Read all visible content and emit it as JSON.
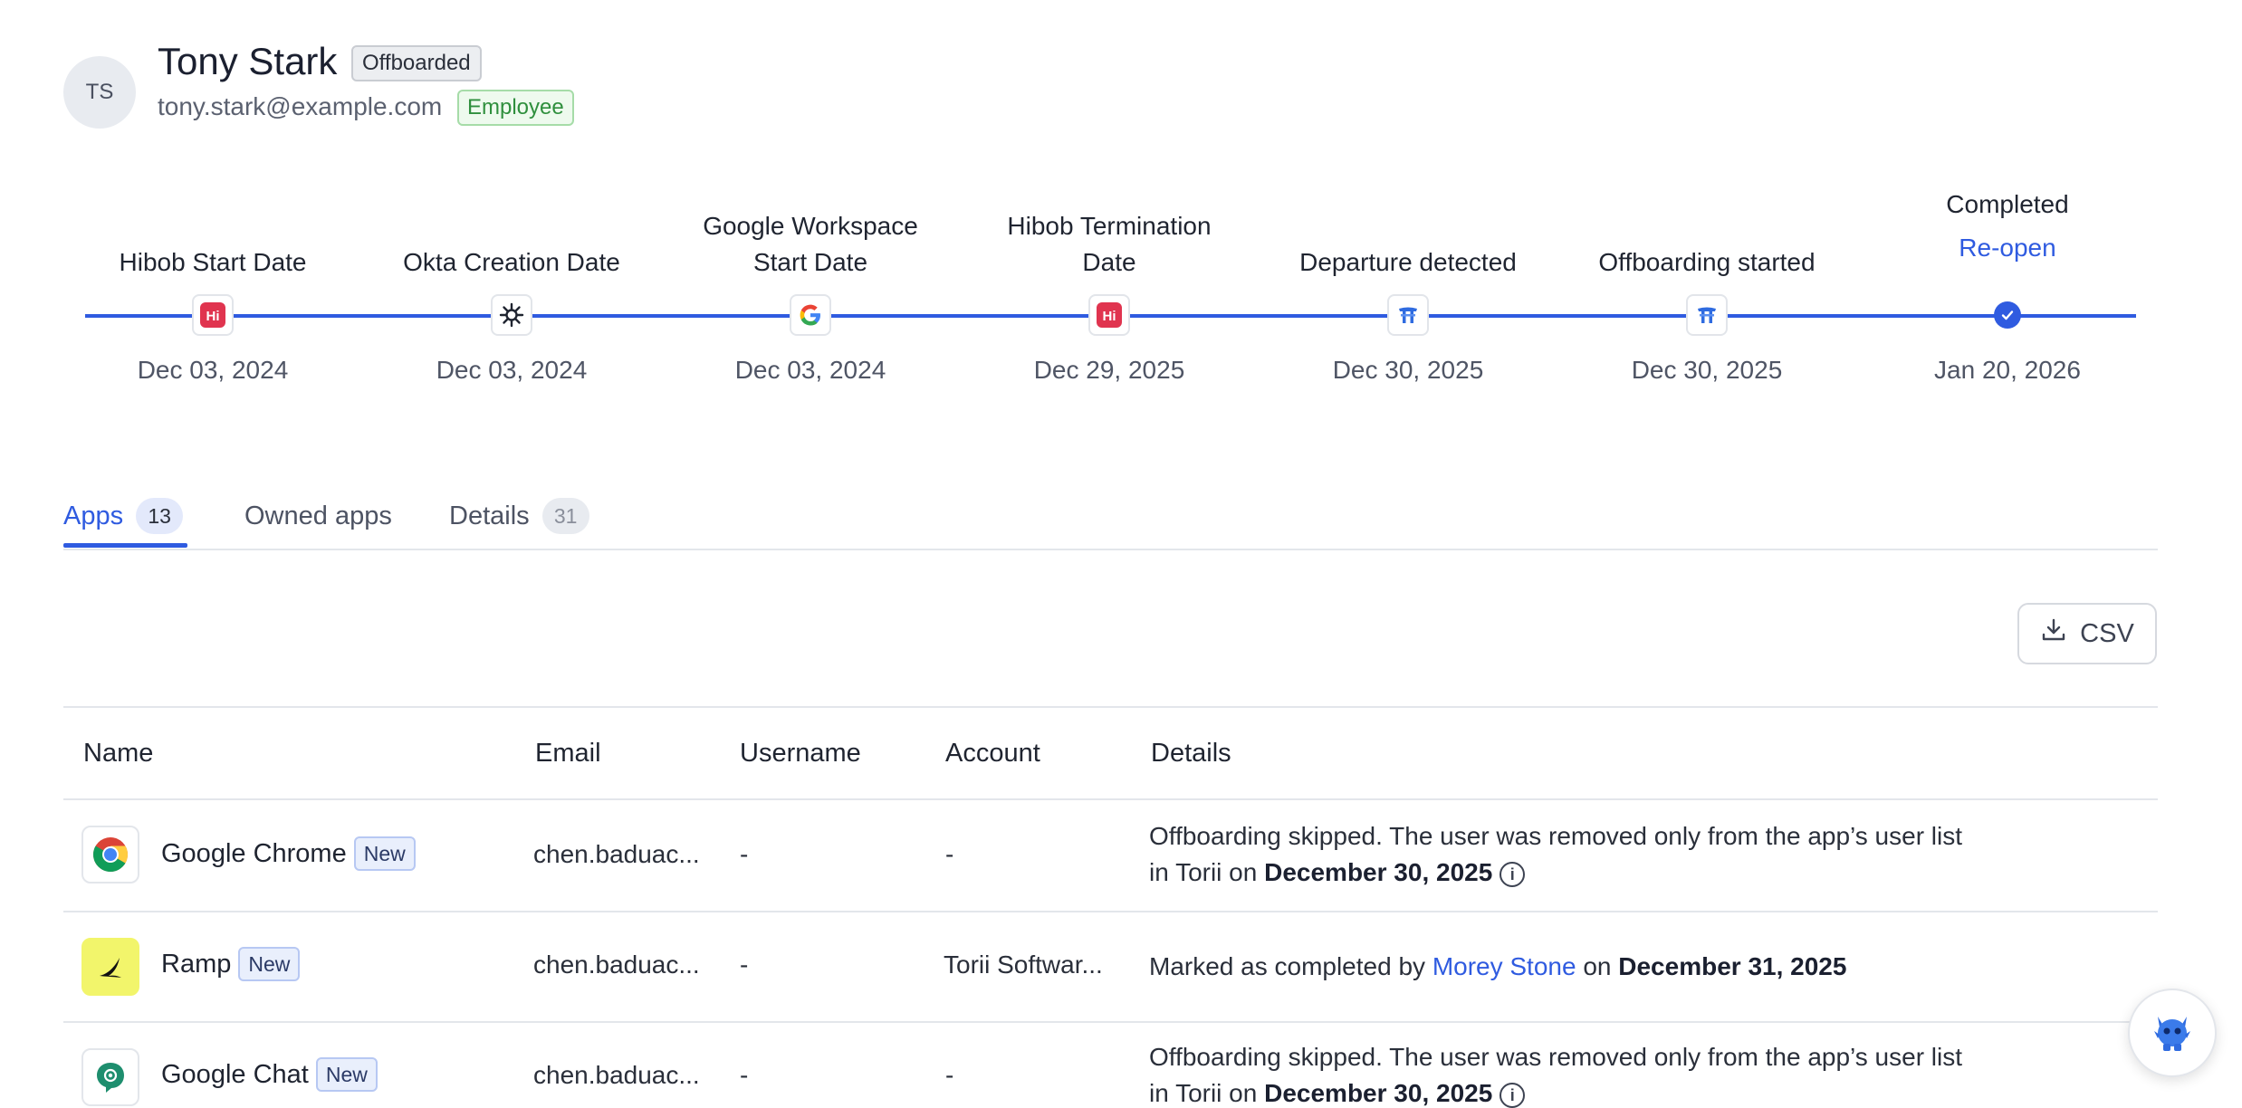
{
  "user": {
    "initials": "TS",
    "name": "Tony Stark",
    "status_badge": "Offboarded",
    "email": "tony.stark@example.com",
    "type_badge": "Employee"
  },
  "timeline": [
    {
      "label_line1": "Hibob Start Date",
      "label_line2": "",
      "date": "Dec 03, 2024",
      "icon": "hibob-icon"
    },
    {
      "label_line1": "Okta Creation Date",
      "label_line2": "",
      "date": "Dec 03, 2024",
      "icon": "okta-icon"
    },
    {
      "label_line1": "Google Workspace",
      "label_line2": "Start Date",
      "date": "Dec 03, 2024",
      "icon": "google-icon"
    },
    {
      "label_line1": "Hibob Termination",
      "label_line2": "Date",
      "date": "Dec 29, 2025",
      "icon": "hibob-icon"
    },
    {
      "label_line1": "Departure detected",
      "label_line2": "",
      "date": "Dec 30, 2025",
      "icon": "torii-icon"
    },
    {
      "label_line1": "Offboarding started",
      "label_line2": "",
      "date": "Dec 30, 2025",
      "icon": "torii-icon"
    },
    {
      "label_line1": "Completed",
      "label_line2": "",
      "date": "Jan 20, 2026",
      "icon": "check-circle-icon",
      "action": "Re-open"
    }
  ],
  "tabs": [
    {
      "label": "Apps",
      "count": "13",
      "active": true
    },
    {
      "label": "Owned apps",
      "count": ""
    },
    {
      "label": "Details",
      "count": "31"
    }
  ],
  "csv_label": "CSV",
  "table": {
    "columns": [
      "Name",
      "Email",
      "Username",
      "Account",
      "Details"
    ],
    "rows": [
      {
        "name": "Google Chrome",
        "badge": "New",
        "icon": "chrome-icon",
        "email": "chen.baduac...",
        "username": "-",
        "account": "-",
        "details_line1": "Offboarding skipped. The user was removed only from the app’s user list",
        "details_line2_prefix": "in Torii on ",
        "details_date": "December 30, 2025"
      },
      {
        "name": "Ramp",
        "badge": "New",
        "icon": "ramp-icon",
        "email": "chen.baduac...",
        "username": "-",
        "account": "Torii Softwar...",
        "details_prefix": "Marked as completed by ",
        "details_person": "Morey Stone",
        "details_mid": " on ",
        "details_date": "December 31, 2025"
      },
      {
        "name": "Google Chat",
        "badge": "New",
        "icon": "google-chat-icon",
        "email": "chen.baduac...",
        "username": "-",
        "account": "-",
        "details_line1": "Offboarding skipped. The user was removed only from the app’s user list",
        "details_line2_prefix": "in Torii on ",
        "details_date": "December 30, 2025"
      }
    ]
  },
  "colors": {
    "accent": "#2f5be0",
    "hibob": "#e0344f",
    "torii": "#2f6be0",
    "ramp_bg": "#f2f56b"
  }
}
